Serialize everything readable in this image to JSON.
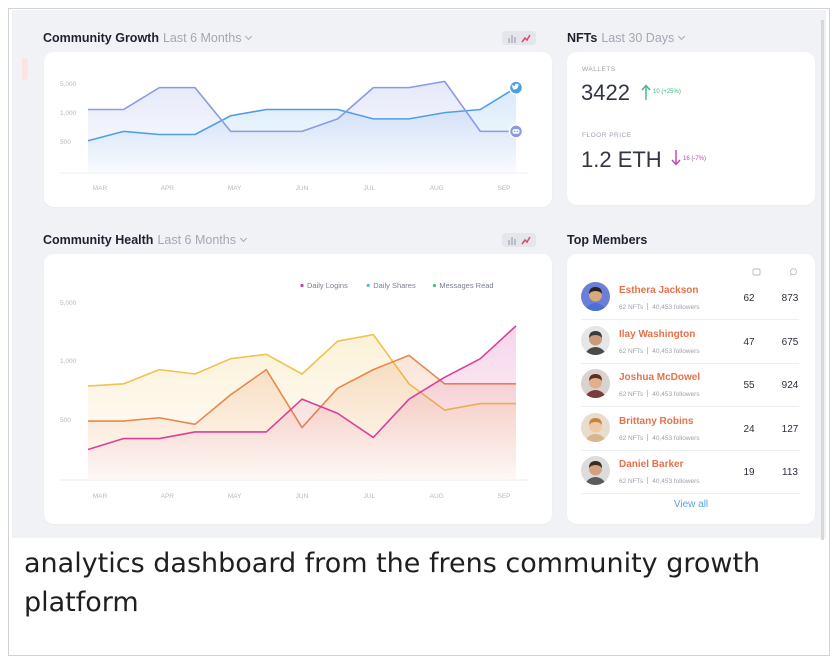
{
  "community_growth": {
    "title": "Community Growth",
    "period": "Last 6 Months",
    "chart_data": {
      "type": "area",
      "categories": [
        "MAR",
        "APR",
        "MAY",
        "JUN",
        "JUL",
        "AUG",
        "SEP"
      ],
      "y_ticks": [
        "5,000",
        "1,000",
        "500"
      ],
      "series": [
        {
          "icon": "twitter-icon",
          "color": "#4a9ee8",
          "values": [
            5.0,
            6.5,
            6.0,
            6.0,
            9.0,
            10.0,
            10.0,
            10.0,
            8.5,
            8.5,
            9.5,
            10.0,
            13.5
          ]
        },
        {
          "icon": "discord-icon",
          "color": "#8a9be6",
          "values": [
            10.0,
            10.0,
            13.5,
            13.5,
            6.5,
            6.5,
            6.5,
            8.5,
            13.5,
            13.5,
            14.5,
            6.5,
            6.5
          ]
        }
      ]
    }
  },
  "nfts": {
    "title": "NFTs",
    "period": "Last 30 Days",
    "wallets": {
      "label": "WALLETS",
      "value": "3422",
      "delta": "10 (+25%)",
      "direction": "up",
      "color": "#35b97e"
    },
    "floor": {
      "label": "FLOOR PRICE",
      "value": "1.2 ETH",
      "delta": "16 (-7%)",
      "direction": "down",
      "color": "#c23fb3"
    }
  },
  "community_health": {
    "title": "Community Health",
    "period": "Last 6 Months",
    "legend": [
      {
        "label": "Daily Logins",
        "color": "#c23fb3"
      },
      {
        "label": "Daily Shares",
        "color": "#58b6e6"
      },
      {
        "label": "Messages Read",
        "color": "#3fbf8a"
      }
    ],
    "chart_data": {
      "type": "area",
      "categories": [
        "MAR",
        "APR",
        "MAY",
        "JUN",
        "JUL",
        "AUG",
        "SEP"
      ],
      "y_ticks": [
        "5,000",
        "1,000",
        "500"
      ],
      "series": [
        {
          "color": "#f0c24e",
          "values": [
            8.5,
            8.7,
            10.0,
            9.6,
            11.0,
            11.4,
            9.6,
            12.6,
            13.2,
            8.7,
            6.3,
            6.9,
            6.9
          ]
        },
        {
          "color": "#e8874f",
          "values": [
            5.3,
            5.3,
            5.6,
            5.0,
            7.7,
            10.0,
            4.7,
            8.3,
            10.0,
            11.3,
            8.7,
            8.7,
            8.7
          ]
        },
        {
          "color": "#d9409c",
          "values": [
            2.7,
            3.7,
            3.7,
            4.3,
            4.3,
            4.3,
            7.3,
            6.0,
            3.8,
            7.3,
            9.3,
            11.0,
            14.0
          ]
        }
      ]
    }
  },
  "top_members": {
    "title": "Top Members",
    "col_icons": [
      "nft-icon",
      "comment-icon"
    ],
    "members": [
      {
        "name": "Esthera Jackson",
        "nfts": "62 NFTs",
        "followers": "40,453 followers",
        "c1": "62",
        "c2": "873",
        "avatar_bg": "#6b7fd6"
      },
      {
        "name": "Ilay Washington",
        "nfts": "62 NFTs",
        "followers": "40,453 followers",
        "c1": "47",
        "c2": "675",
        "avatar_bg": "#e6e6e6"
      },
      {
        "name": "Joshua McDowel",
        "nfts": "62 NFTs",
        "followers": "40,453 followers",
        "c1": "55",
        "c2": "924",
        "avatar_bg": "#d9d2cf"
      },
      {
        "name": "Brittany Robins",
        "nfts": "62 NFTs",
        "followers": "40,453 followers",
        "c1": "24",
        "c2": "127",
        "avatar_bg": "#e8dccd"
      },
      {
        "name": "Daniel Barker",
        "nfts": "62 NFTs",
        "followers": "40,453 followers",
        "c1": "19",
        "c2": "113",
        "avatar_bg": "#dcdcdc"
      }
    ],
    "view_all": "View all"
  },
  "caption": "analytics dashboard from the frens community growth platform"
}
